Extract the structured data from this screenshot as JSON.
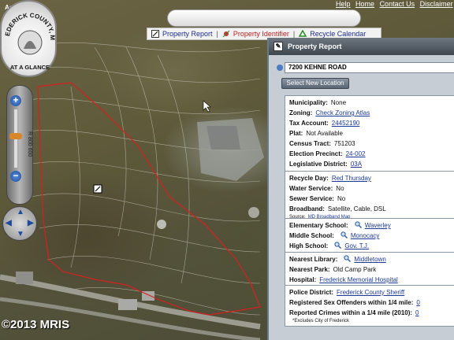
{
  "app": {
    "aerial_label": "Aerial",
    "top_links": [
      "Help",
      "Home",
      "Contact Us",
      "Disclaimer"
    ],
    "seal_text_top": "FREDERICK COUNTY, MD",
    "seal_text_bottom": "AT A GLANCE",
    "scale_label": "R 800  600",
    "copyright": "©2013 MRIS"
  },
  "tools": {
    "property_report": "Property Report",
    "property_identifier": "Property Identifier",
    "recycle_calendar": "Recycle Calendar",
    "separator": "|"
  },
  "panel": {
    "title": "Property Report",
    "address": "7200  KEHNE ROAD",
    "select_button": "Select New Location",
    "group1": [
      {
        "label": "Municipality:",
        "value": "None",
        "link": false
      },
      {
        "label": "Zoning:",
        "value": "Check Zoning Atlas",
        "link": true
      },
      {
        "label": "Tax Account:",
        "value": "24452190",
        "link": true
      },
      {
        "label": "Plat:",
        "value": "Not Available",
        "link": false
      },
      {
        "label": "Census Tract:",
        "value": "751203",
        "link": false
      },
      {
        "label": "Election Precinct:",
        "value": "24-002",
        "link": true
      },
      {
        "label": "Legislative District:",
        "value": "03A",
        "link": true
      }
    ],
    "group2": [
      {
        "label": "Recycle Day:",
        "value": "Red Thursday",
        "link": true
      },
      {
        "label": "Water Service:",
        "value": "No",
        "link": false
      },
      {
        "label": "Sewer Service:",
        "value": "No",
        "link": false
      },
      {
        "label": "Broadband:",
        "value": "Satellite, Cable, DSL",
        "link": false
      }
    ],
    "broadband_source_label": "Source:",
    "broadband_source_link": "MD Broadband Map",
    "group3": [
      {
        "label": "Elementary School:",
        "value": "Waverley",
        "link": true
      },
      {
        "label": "Middle School:",
        "value": "Monocacy",
        "link": true
      },
      {
        "label": "High School:",
        "value": "Gov. T.J.",
        "link": true
      }
    ],
    "group4": [
      {
        "label": "Nearest Library:",
        "value": "Middletown",
        "link": true
      },
      {
        "label": "Nearest Park:",
        "value": "Old Camp Park",
        "link": false
      },
      {
        "label": "Hospital:",
        "value": "Frederick Memorial Hospital",
        "link": true
      }
    ],
    "group5": [
      {
        "label": "Police District:",
        "value": "Frederick County Sheriff",
        "link": true
      },
      {
        "label": "Registered Sex Offenders within 1/4 mile:",
        "value": "0",
        "link": true
      },
      {
        "label": "Reported Crimes within a 1/4 mile (2010):",
        "value": "0",
        "link": true
      }
    ],
    "footnote": "*Excludes City of Frederick"
  },
  "colors": {
    "parcel_outline": "#d62020",
    "panel_bg": "#c6cdd4",
    "link": "#1d3a9a"
  }
}
